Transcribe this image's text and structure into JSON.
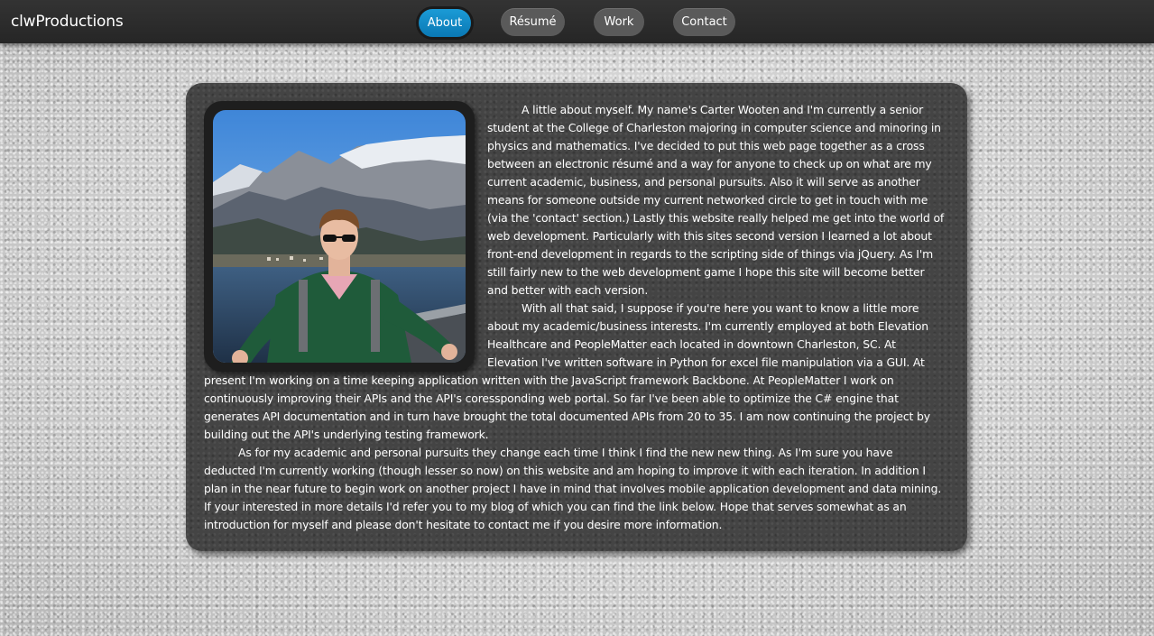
{
  "header": {
    "brand": "clwProductions",
    "nav": [
      {
        "label": "About",
        "active": true
      },
      {
        "label": "Résumé",
        "active": false
      },
      {
        "label": "Work",
        "active": false
      },
      {
        "label": "Contact",
        "active": false
      }
    ]
  },
  "about": {
    "paragraphs": [
      "A little about myself. My name's Carter Wooten and I'm currently a senior student at the College of Charleston majoring in computer science and minoring in physics and mathematics. I've decided to put this web page together as a cross between an electronic résumé and a way for anyone to check up on what are my current academic, business, and personal pursuits. Also it will serve as another means for someone outside my current networked circle to get in touch with me (via the 'contact' section.) Lastly this website really helped me get into the world of web development. Particularly with this sites second version I learned a lot about front-end development in regards to the scripting side of things via jQuery. As I'm still fairly new to the web development game I hope this site will become better and better with each version.",
      "With all that said, I suppose if you're here you want to know a little more about my academic/business interests. I'm currently employed at both Elevation Healthcare and PeopleMatter each located in downtown Charleston, SC. At Elevation I've written software in Python for excel file manipulation via a GUI. At present I'm working on a time keeping application written with the JavaScript framework Backbone. At PeopleMatter I work on continuously improving their APIs and the API's coressponding web portal. So far I've been able to optimize the C# engine that generates API documentation and in turn have brought the total documented APIs from 20 to 35. I am now continuing the project by building out the API's underlying testing framework.",
      "As for my academic and personal pursuits they change each time I think I find the new new thing. As I'm sure you have deducted I'm currently working (though lesser so now) on this website and am hoping to improve it with each iteration. In addition I plan in the near future to begin work on another project I have in mind that involves mobile application development and data mining. If your interested in more details I'd refer you to my blog of which you can find the link below. Hope that serves somewhat as an introduction for myself and please don't hesitate to contact me if you desire more information."
    ]
  },
  "colors": {
    "topbar": "#2d2d2d",
    "active_nav": "#1b9bd6",
    "inactive_nav": "#5a5a5a",
    "panel": "#444444",
    "text": "#ffffff"
  }
}
